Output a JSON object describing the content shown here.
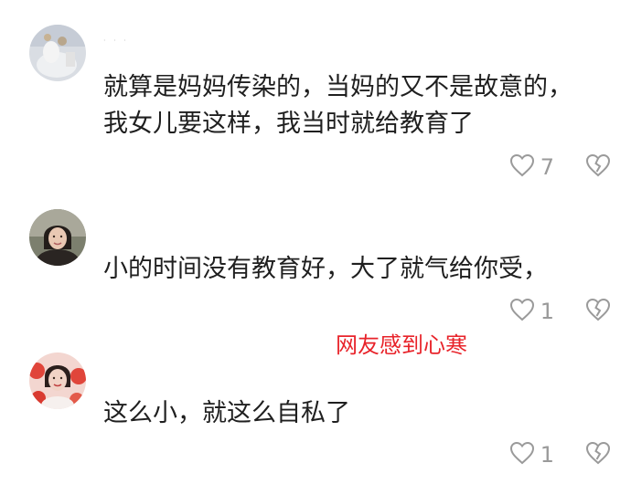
{
  "comments": [
    {
      "line1": "就算是妈妈传染的，当妈的又不是故意的，",
      "line2": "我女儿要这样，我当时就给教育了",
      "likes": "7",
      "like_icon": "heart-outline-icon",
      "dislike_icon": "broken-heart-icon"
    },
    {
      "line1": "小的时间没有教育好，大了就气给你受，",
      "likes": "1",
      "like_icon": "heart-outline-icon",
      "dislike_icon": "broken-heart-icon"
    },
    {
      "line1": "这么小，就这么自私了",
      "likes": "1",
      "like_icon": "heart-outline-icon",
      "dislike_icon": "broken-heart-icon"
    }
  ],
  "overlay_caption": "网友感到心寒",
  "colors": {
    "caption": "#e8232a",
    "icon": "#9a9a9a",
    "text": "#1f1f1f"
  }
}
